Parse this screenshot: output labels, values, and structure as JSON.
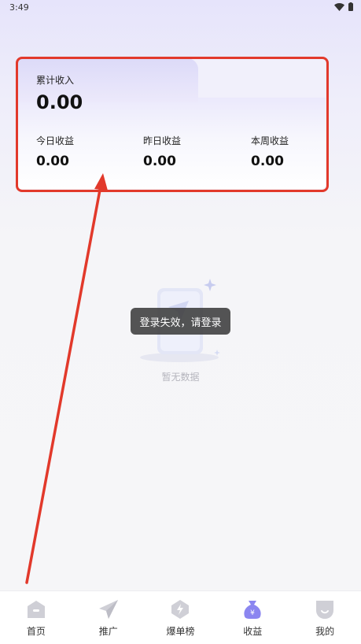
{
  "status_bar": {
    "time": "3:49"
  },
  "earnings_card": {
    "total_label": "累计收入",
    "total_value": "0.00",
    "stats": [
      {
        "label": "今日收益",
        "value": "0.00"
      },
      {
        "label": "昨日收益",
        "value": "0.00"
      },
      {
        "label": "本周收益",
        "value": "0.00"
      }
    ]
  },
  "empty_state": {
    "text": "暂无数据"
  },
  "toast": {
    "text": "登录失效，请登录"
  },
  "tabbar": {
    "items": [
      {
        "label": "首页",
        "icon": "home-icon"
      },
      {
        "label": "推广",
        "icon": "paper-plane-icon"
      },
      {
        "label": "爆单榜",
        "icon": "hot-list-icon"
      },
      {
        "label": "收益",
        "icon": "money-bag-icon"
      },
      {
        "label": "我的",
        "icon": "profile-icon"
      }
    ],
    "active": "收益"
  },
  "colors": {
    "accent": "#8b86f0",
    "annotation": "#e2392b",
    "icon_inactive": "#cfcfd6"
  }
}
